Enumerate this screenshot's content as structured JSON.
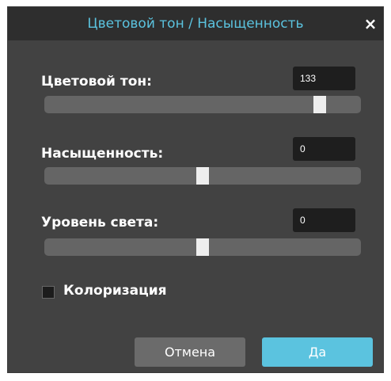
{
  "dialog": {
    "title": "Цветовой тон / Насыщенность",
    "close_glyph": "×",
    "close_icon": "close-icon"
  },
  "hue": {
    "label": "Цветовой тон:",
    "value": "133",
    "slider_fraction": 0.87
  },
  "saturation": {
    "label": "Насыщенность:",
    "value": "0",
    "slider_fraction": 0.5
  },
  "lightness": {
    "label": "Уровень света:",
    "value": "0",
    "slider_fraction": 0.5
  },
  "colorize": {
    "label": "Колоризация",
    "checked": false
  },
  "buttons": {
    "cancel": "Отмена",
    "ok": "Да"
  },
  "colors": {
    "accent": "#5bc3df",
    "panel": "#424242",
    "titlebar": "#2e2e2e"
  }
}
